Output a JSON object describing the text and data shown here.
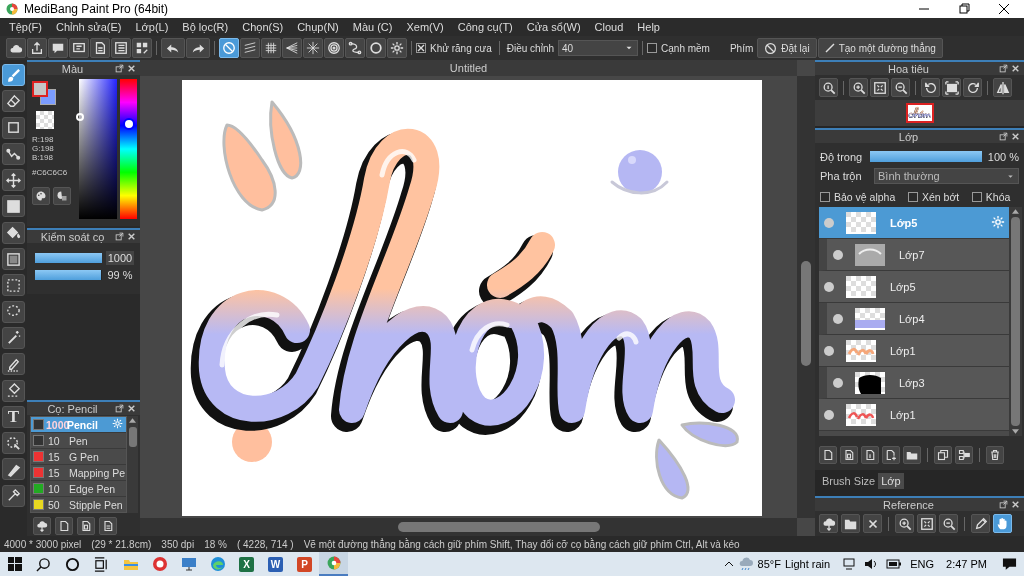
{
  "window": {
    "title": "MediBang Paint Pro (64bit)"
  },
  "menu": [
    "Tệp(F)",
    "Chỉnh sửa(E)",
    "Lớp(L)",
    "Bộ lọc(R)",
    "Chọn(S)",
    "Chụp(N)",
    "Màu (C)",
    "Xem(V)",
    "Công cụ(T)",
    "Cửa sổ(W)",
    "Cloud",
    "Help"
  ],
  "toolbar": {
    "snaps": [
      {
        "kind": "none",
        "selected": true
      },
      {
        "kind": "parallel",
        "selected": false
      },
      {
        "kind": "grid",
        "selected": false
      },
      {
        "kind": "perspective",
        "selected": false
      },
      {
        "kind": "radial",
        "selected": false
      },
      {
        "kind": "concentric",
        "selected": false
      },
      {
        "kind": "curve",
        "selected": false
      },
      {
        "kind": "circle",
        "selected": false
      },
      {
        "kind": "settings",
        "selected": false
      }
    ],
    "antialias": {
      "label": "Khử răng cưa",
      "checked": true
    },
    "correction": {
      "label": "Điều chỉnh",
      "value": "40"
    },
    "soft_edge": {
      "label": "Cạnh mềm",
      "checked": false
    },
    "key_label": "Phím",
    "reset_button": "Đặt lại",
    "line_button": "Tạo một đường thẳng"
  },
  "tools": [
    {
      "kind": "brush",
      "selected": true
    },
    {
      "kind": "eraser",
      "selected": false
    },
    {
      "kind": "dot",
      "selected": false
    },
    {
      "kind": "polyline",
      "selected": false
    },
    {
      "kind": "move",
      "selected": false
    },
    {
      "kind": "fillrect",
      "selected": false
    },
    {
      "kind": "bucket",
      "selected": false
    },
    {
      "kind": "gradient",
      "selected": false
    },
    {
      "kind": "selrect",
      "selected": false
    },
    {
      "kind": "lasso",
      "selected": false
    },
    {
      "kind": "wand",
      "selected": false
    },
    {
      "kind": "selpen",
      "selected": false
    },
    {
      "kind": "seleraser",
      "selected": false
    },
    {
      "kind": "text",
      "label": "T",
      "selected": false
    },
    {
      "kind": "selarrow",
      "selected": false
    },
    {
      "kind": "knife",
      "selected": false
    },
    {
      "kind": "dropper",
      "selected": false
    }
  ],
  "color_panel": {
    "title": "Màu",
    "hue": {
      "level": 0.68
    },
    "r": "R:198",
    "g": "G:198",
    "b": "B:198",
    "hex": "#C6C6C6"
  },
  "brush_control": {
    "title": "Kiểm soát cọ",
    "size": {
      "value": "1000",
      "level": 1
    },
    "opacity": {
      "value": "99 %",
      "level": 0.99
    }
  },
  "brush_panel": {
    "title": "Cọ: Pencil",
    "items": [
      {
        "size": "1000",
        "name": "Pencil",
        "color": "#333333",
        "selected": true
      },
      {
        "size": "10",
        "name": "Pen",
        "color": "#333333",
        "selected": false
      },
      {
        "size": "15",
        "name": "G Pen",
        "color": "#ee3333",
        "selected": false
      },
      {
        "size": "15",
        "name": "Mapping Pe",
        "color": "#ee3333",
        "selected": false
      },
      {
        "size": "10",
        "name": "Edge Pen",
        "color": "#22aa22",
        "selected": false
      },
      {
        "size": "50",
        "name": "Stipple Pen",
        "color": "#e8d820",
        "selected": false
      }
    ]
  },
  "canvas": {
    "tab": "Untitled"
  },
  "navigator": {
    "title": "Hoa tiêu"
  },
  "layers": {
    "title": "Lớp",
    "opacity_label": "Độ trong",
    "opacity": {
      "level": 1,
      "value": "100 %"
    },
    "blend_label": "Pha trộn",
    "blend": "Bình thường",
    "options": [
      {
        "label": "Bảo vệ alpha",
        "checked": false
      },
      {
        "label": "Xén bớt",
        "checked": false
      },
      {
        "label": "Khóa",
        "checked": false
      }
    ],
    "items": [
      {
        "name": "Lớp5",
        "thumbnail": {
          "kind": "checker"
        },
        "clipped": false,
        "selected": true
      },
      {
        "name": "Lớp7",
        "thumbnail": {
          "kind": "gray"
        },
        "clipped": true,
        "selected": false
      },
      {
        "name": "Lớp5",
        "thumbnail": {
          "kind": "checker"
        },
        "clipped": false,
        "selected": false
      },
      {
        "name": "Lớp4",
        "thumbnail": {
          "kind": "blue"
        },
        "clipped": true,
        "selected": false
      },
      {
        "name": "Lớp1",
        "thumbnail": {
          "kind": "peach"
        },
        "clipped": false,
        "selected": false
      },
      {
        "name": "Lớp3",
        "thumbnail": {
          "kind": "black"
        },
        "clipped": true,
        "selected": false
      },
      {
        "name": "Lớp1",
        "thumbnail": {
          "kind": "red"
        },
        "clipped": false,
        "selected": false
      }
    ],
    "tabs": [
      {
        "label": "Brush Size",
        "selected": false
      },
      {
        "label": "Lớp",
        "selected": true
      }
    ]
  },
  "reference": {
    "title": "Reference",
    "tools": [
      {
        "kind": "pen",
        "selected": false
      },
      {
        "kind": "hand",
        "selected": true
      }
    ]
  },
  "status_bar": {
    "size": "4000 * 3000 pixel",
    "physical": "(29 * 21.8cm)",
    "dpi": "350 dpi",
    "zoom": "18 %",
    "position": "( 4228, 714 )",
    "hint": "Vẽ một đường thẳng bằng cách giữ phím Shift, Thay đổi cỡ cọ bằng cách giữ phím Ctrl, Alt và kéo"
  },
  "taskbar": {
    "apps": [
      {
        "kind": "explorer",
        "selected": false
      },
      {
        "kind": "redapp",
        "selected": false
      },
      {
        "kind": "monitor",
        "selected": false
      },
      {
        "kind": "edge",
        "selected": false
      },
      {
        "kind": "excel",
        "label": "X",
        "selected": false
      },
      {
        "kind": "word",
        "label": "W",
        "selected": false
      },
      {
        "kind": "powerpoint",
        "label": "P",
        "selected": false
      },
      {
        "kind": "medibang",
        "selected": true
      }
    ],
    "temperature": "85°F",
    "weather": "Light rain",
    "language": "ENG",
    "time": "2:47 PM"
  }
}
